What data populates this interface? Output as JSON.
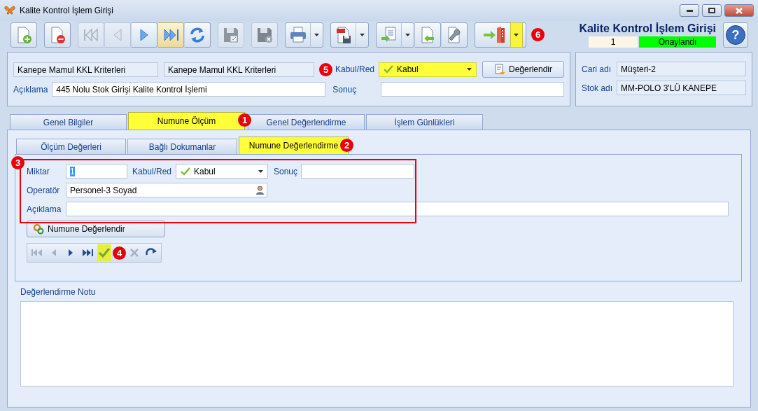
{
  "window": {
    "title": "Kalite Kontrol İşlem Girişi"
  },
  "toolbar": {
    "buttons": [
      {
        "kind": "new",
        "disabled": false,
        "highlighted": false,
        "joined": false
      },
      {
        "kind": "delete",
        "disabled": false,
        "highlighted": false,
        "joined": false
      },
      {
        "kind": "first",
        "disabled": true,
        "highlighted": false,
        "joined": false
      },
      {
        "kind": "prev",
        "disabled": true,
        "highlighted": false,
        "joined": true
      },
      {
        "kind": "next",
        "disabled": false,
        "highlighted": false,
        "joined": true
      },
      {
        "kind": "last",
        "disabled": false,
        "highlighted": true,
        "joined": true
      },
      {
        "kind": "refresh",
        "disabled": false,
        "highlighted": false,
        "joined": true
      },
      {
        "kind": "save",
        "disabled": true,
        "highlighted": false,
        "joined": false
      },
      {
        "kind": "cancel",
        "disabled": true,
        "highlighted": false,
        "joined": false
      },
      {
        "kind": "print",
        "disabled": false,
        "highlighted": false,
        "dropdown": true,
        "joined": false
      },
      {
        "kind": "pdf",
        "disabled": false,
        "highlighted": false,
        "dropdown": true,
        "joined": false
      },
      {
        "kind": "export",
        "disabled": false,
        "highlighted": false,
        "dropdown": true,
        "joined": false
      },
      {
        "kind": "import",
        "disabled": false,
        "highlighted": false,
        "joined": true
      },
      {
        "kind": "settings",
        "disabled": false,
        "highlighted": false,
        "joined": true
      },
      {
        "kind": "exit",
        "disabled": false,
        "highlighted": false,
        "dropdown": true,
        "dropdown_highlighted": true,
        "joined": false,
        "annotation": "6"
      }
    ]
  },
  "header": {
    "title": "Kalite Kontrol İşlem Girişi",
    "record_no": "1",
    "status": "Onaylandı",
    "help": "?"
  },
  "criteria": {
    "code": "Kanepe Mamul KKL Kriterleri",
    "name": "Kanepe Mamul KKL Kriterleri",
    "description_label": "Açıklama",
    "description": "445 Nolu Stok Girişi Kalite Kontrol İşlemi",
    "decision_label": "Kabul/Red",
    "decision": "Kabul",
    "decision_highlighted": true,
    "decision_annotation": "5",
    "result_label": "Sonuç",
    "evaluate_button": "Değerlendir"
  },
  "customer": {
    "fields": [
      {
        "label": "Cari adı",
        "value": "Müşteri-2"
      },
      {
        "label": "Stok adı",
        "value": "MM-POLO 3'LÜ KANEPE"
      }
    ]
  },
  "tabs": [
    {
      "label": "Genel Bilgiler",
      "selected": false
    },
    {
      "label": "Numune Ölçüm",
      "selected": true,
      "annotation": "1"
    },
    {
      "label": "Genel Değerlendirme",
      "selected": false
    },
    {
      "label": "İşlem Günlükleri",
      "selected": false
    }
  ],
  "subtabs": [
    {
      "label": "Ölçüm Değerleri",
      "selected": false
    },
    {
      "label": "Bağlı Dokumanlar",
      "selected": false
    },
    {
      "label": "Numune Değerlendirme",
      "selected": true,
      "annotation": "2"
    }
  ],
  "sample": {
    "annotation": "3",
    "quantity_label": "Miktar",
    "quantity": "1",
    "quantity_selected": true,
    "decision_label": "Kabul/Red",
    "decision": "Kabul",
    "result_label": "Sonuç",
    "operator_label": "Operatör",
    "operator": "Personel-3 Soyad",
    "description_label": "Açıklama",
    "evaluate_button": "Numune Değerlendir"
  },
  "navigator": {
    "buttons": [
      {
        "kind": "first",
        "disabled": true,
        "highlighted": false
      },
      {
        "kind": "prev",
        "disabled": true,
        "highlighted": false
      },
      {
        "kind": "next",
        "disabled": false,
        "highlighted": false
      },
      {
        "kind": "last",
        "disabled": false,
        "highlighted": false
      },
      {
        "kind": "post",
        "disabled": false,
        "highlighted": true,
        "annotation": "4"
      },
      {
        "kind": "cancel",
        "disabled": true,
        "highlighted": false
      },
      {
        "kind": "refresh",
        "disabled": false,
        "highlighted": false
      }
    ]
  },
  "notes": {
    "label": "Değerlendirme Notu"
  }
}
